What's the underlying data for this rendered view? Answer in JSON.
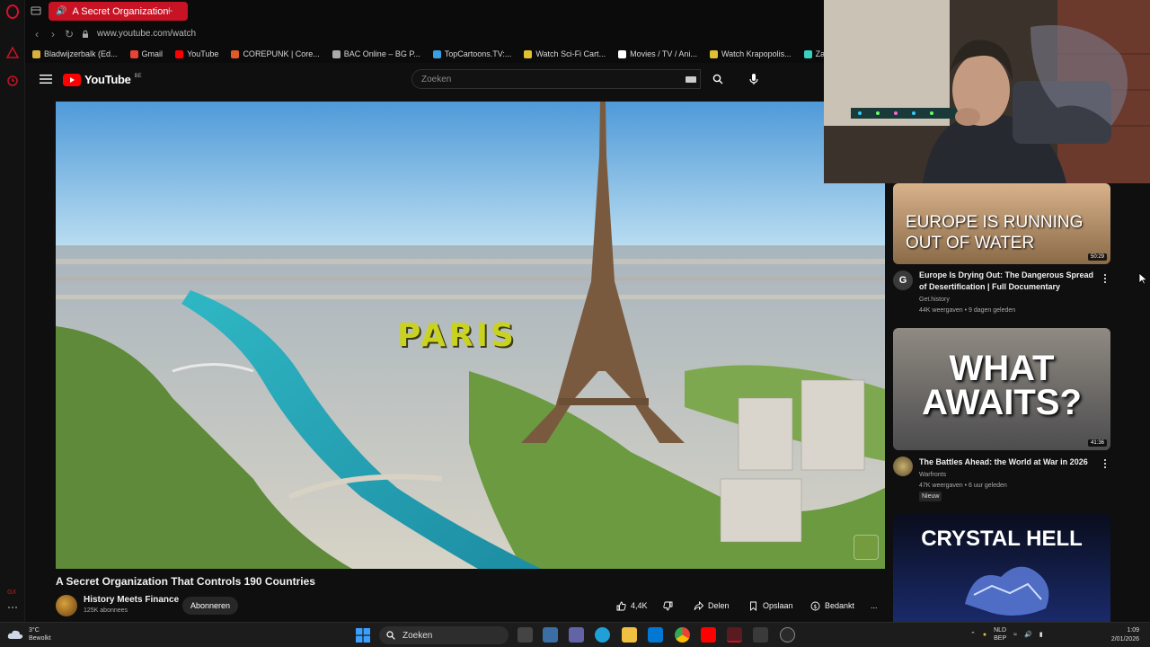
{
  "browser": {
    "active_tab_title": "A Secret Organization",
    "new_tab": "+",
    "url": "www.youtube.com/watch",
    "bookmarks": [
      {
        "label": "Bladwijzerbalk (Ed...",
        "color": "#d9b13b"
      },
      {
        "label": "Gmail",
        "color": "#ea4335"
      },
      {
        "label": "YouTube",
        "color": "#ff0000"
      },
      {
        "label": "COREPUNK | Core...",
        "color": "#e05a2a"
      },
      {
        "label": "BAC Online – BG P...",
        "color": "#aaaaaa"
      },
      {
        "label": "TopCartoons.TV:...",
        "color": "#3aa0e0"
      },
      {
        "label": "Watch Sci-Fi Cart...",
        "color": "#e0c030"
      },
      {
        "label": "Movies / TV / Ani...",
        "color": "#ffffff"
      },
      {
        "label": "Watch Krapopolis...",
        "color": "#e0c030"
      },
      {
        "label": "Zamnesia |",
        "color": "#3ad0c0"
      }
    ]
  },
  "youtube": {
    "logo_text": "YouTube",
    "logo_region": "BE",
    "search_placeholder": "Zoeken"
  },
  "video": {
    "caption": "PARIS",
    "title": "A Secret Organization That Controls 190 Countries",
    "channel_name": "History Meets Finance",
    "channel_subs": "125K abonnees",
    "subscribe_label": "Abonneren",
    "likes": "4,4K",
    "share_label": "Delen",
    "save_label": "Opslaan",
    "thanks_label": "Bedankt",
    "more_label": "..."
  },
  "recommendations": [
    {
      "thumb_text_1": "EUROPE IS RUNNING",
      "thumb_text_2": "OUT OF WATER",
      "duration": "50:29",
      "avatar_letter": "G",
      "title": "Europe Is Drying Out: The Dangerous Spread of Desertification | Full Documentary",
      "channel": "Get.history",
      "meta": "44K weergaven • 9 dagen geleden",
      "badge": ""
    },
    {
      "thumb_text_1": "WHAT",
      "thumb_text_2": "AWAITS?",
      "duration": "41:36",
      "avatar_letter": "",
      "title": "The Battles Ahead: the World at War in 2026",
      "channel": "Warfronts",
      "meta": "47K weergaven • 6 uur geleden",
      "badge": "Nieuw"
    },
    {
      "thumb_text_1": "CRYSTAL HELL",
      "thumb_text_2": "",
      "duration": "",
      "avatar_letter": "",
      "title": "",
      "channel": "",
      "meta": "",
      "badge": ""
    }
  ],
  "taskbar": {
    "temperature": "3°C",
    "weather": "Bewolkt",
    "search_label": "Zoeken",
    "lang_1": "NLD",
    "lang_2": "BEP",
    "time": "1:09",
    "date": "2/01/2026"
  },
  "colors": {
    "youtube_red": "#ff0000",
    "opera_red": "#c81325",
    "background": "#0f0f0f"
  }
}
